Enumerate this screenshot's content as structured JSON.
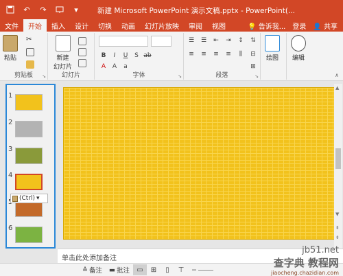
{
  "app": {
    "title": "新建 Microsoft PowerPoint 演示文稿.pptx - PowerPoint(..."
  },
  "qat": {
    "save_icon": "save-icon",
    "undo_icon": "undo-icon",
    "redo_icon": "redo-icon",
    "slideshow_icon": "slideshow-icon",
    "customize_icon": "customize-icon"
  },
  "tabs": [
    {
      "label": "文件"
    },
    {
      "label": "开始"
    },
    {
      "label": "插入"
    },
    {
      "label": "设计"
    },
    {
      "label": "切换"
    },
    {
      "label": "动画"
    },
    {
      "label": "幻灯片放映"
    },
    {
      "label": "审阅"
    },
    {
      "label": "视图"
    }
  ],
  "tell_me": "告诉我...",
  "account": {
    "login": "登录",
    "share": "共享"
  },
  "ribbon": {
    "clipboard": {
      "paste": "粘贴",
      "label": "剪贴板"
    },
    "slides": {
      "new_slide": "新建\n幻灯片",
      "new_slide_l1": "新建",
      "new_slide_l2": "幻灯片",
      "label": "幻灯片"
    },
    "font": {
      "label": "字体"
    },
    "paragraph": {
      "label": "段落"
    },
    "drawing": {
      "label": "绘图"
    },
    "editing": {
      "label": "编辑"
    }
  },
  "thumbnails": [
    {
      "num": "1",
      "color": "#f2c21c"
    },
    {
      "num": "2",
      "color": "#b3b3b3"
    },
    {
      "num": "3",
      "color": "#8a9a3a"
    },
    {
      "num": "4",
      "color": "#f2c21c"
    },
    {
      "num": "5",
      "color": "#c36a2a"
    },
    {
      "num": "6",
      "color": "#7cb342"
    }
  ],
  "paste_options": "(Ctrl)",
  "notes_placeholder": "单击此处添加备注",
  "status": {
    "notes": "备注",
    "comments": "批注"
  },
  "watermark": {
    "site": "jb51.net",
    "text": "查字典 教程网",
    "url": "jiaocheng.chazidian.com"
  },
  "colors": {
    "accent": "#d24726",
    "slide": "#f2c21c",
    "selection": "#2b88d8"
  }
}
